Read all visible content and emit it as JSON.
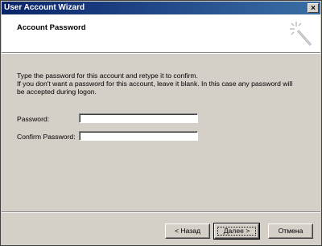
{
  "window": {
    "title": "User Account Wizard",
    "close_icon": "close-icon",
    "close_symbol": "×"
  },
  "header": {
    "title": "Account Password",
    "icon": "wizard-wand-icon"
  },
  "main": {
    "description_line1": "Type the password for this account and retype it to confirm.",
    "description_line2": "If you don't want a password for this account, leave it blank. In this case any password will",
    "description_line3": "be accepted during logon.",
    "password_label": "Password:",
    "password_value": "",
    "confirm_label": "Confirm Password:",
    "confirm_value": ""
  },
  "buttons": {
    "back_label": "< Назад",
    "next_label": "Далее >",
    "cancel_label": "Отмена"
  },
  "colors": {
    "titlebar_start": "#0a246a",
    "titlebar_end": "#3a6ea5",
    "dialog_bg": "#d4d0c8"
  }
}
